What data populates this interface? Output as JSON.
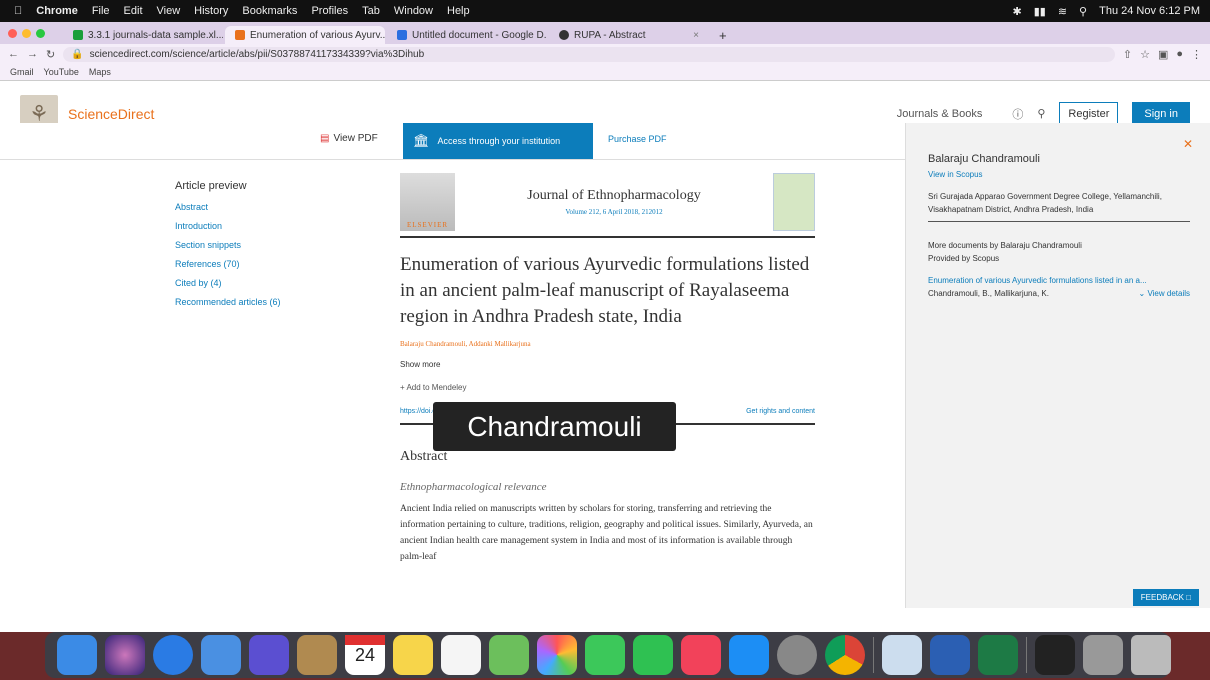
{
  "menubar": {
    "items": [
      "Chrome",
      "File",
      "Edit",
      "View",
      "History",
      "Bookmarks",
      "Profiles",
      "Tab",
      "Window",
      "Help"
    ],
    "clock": "Thu 24 Nov 6:12 PM"
  },
  "tabs": [
    {
      "label": "3.3.1 journals-data sample.xl...",
      "color": "#1a9e3a"
    },
    {
      "label": "Enumeration of various Ayurv...",
      "color": "#e9711c"
    },
    {
      "label": "Untitled document - Google D...",
      "color": "#2b6fe0"
    },
    {
      "label": "RUPA - Abstract",
      "color": "#333333"
    }
  ],
  "address": {
    "url": "sciencedirect.com/science/article/abs/pii/S0378874117334339?via%3Dihub"
  },
  "bookmarks": [
    "Gmail",
    "YouTube",
    "Maps"
  ],
  "header": {
    "brand": "ScienceDirect",
    "journals": "Journals & Books",
    "register": "Register",
    "signin": "Sign in"
  },
  "subbar": {
    "view_pdf": "View PDF",
    "access": "Access through your institution",
    "purchase": "Purchase PDF"
  },
  "outline": {
    "title": "Article preview",
    "links": [
      "Abstract",
      "Introduction",
      "Section snippets",
      "References (70)",
      "Cited by (4)",
      "Recommended articles (6)"
    ]
  },
  "article": {
    "journal": "Journal of Ethnopharmacology",
    "volume": "Volume 212, 6 April 2018, 212012",
    "publisher": "ELSEVIER",
    "title": "Enumeration of various Ayurvedic formulations listed in an ancient palm-leaf manuscript of Rayalaseema region in Andhra Pradesh state, India",
    "authors": "Balaraju Chandramouli, Addanki Mallikarjuna",
    "show_more": "Show more",
    "add_to": "+ Add to Mendeley",
    "doi": "https://doi.org/10.1016/j.jep.2017.12.013",
    "rights": "Get rights and content",
    "abstract_heading": "Abstract",
    "abstract_sub": "Ethnopharmacological relevance",
    "abstract_text": "Ancient India relied on manuscripts written by scholars for storing, transferring and retrieving the information pertaining to culture, traditions, religion, geography and political issues. Similarly, Ayurveda, an ancient Indian health care management system in India and most of its information is available through palm-leaf"
  },
  "tooltip": "Chandramouli",
  "sidepanel": {
    "name": "Balaraju Chandramouli",
    "view_scopus": "View in Scopus",
    "affiliation": "Sri Gurajada Apparao Government Degree College, Yellamanchili, Visakhapatnam District, Andhra Pradesh, India",
    "more_docs": "More documents by Balaraju Chandramouli",
    "provided": "Provided by Scopus",
    "doc_title": "Enumeration of various Ayurvedic formulations listed in an a...",
    "doc_authors": "Chandramouli, B., Mallikarjuna, K.",
    "view_details": "View details",
    "feedback": "FEEDBACK"
  },
  "dock": {
    "calendar_day": "24",
    "calendar_month": "NOV"
  }
}
